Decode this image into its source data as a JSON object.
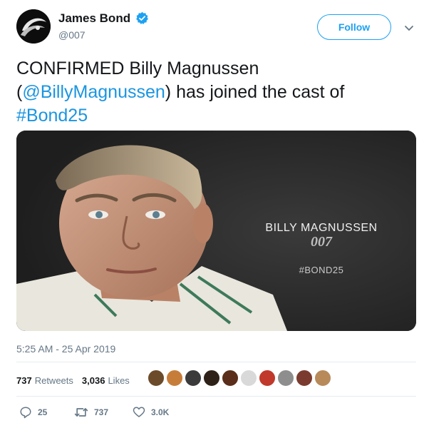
{
  "header": {
    "display_name": "James Bond",
    "handle": "@007",
    "follow_label": "Follow",
    "verified_icon": "verified-badge-icon",
    "menu_icon": "chevron-down-icon"
  },
  "tweet": {
    "text_part1": "CONFIRMED Billy Magnussen",
    "text_paren_open": "(",
    "mention": "@BillyMagnussen",
    "text_part2": ") has joined the cast of",
    "hashtag": "#Bond25"
  },
  "media": {
    "title": "BILLY MAGNUSSEN",
    "logo": "007",
    "tag": "#BOND25"
  },
  "timestamp": "5:25 AM - 25 Apr 2019",
  "stats": {
    "retweets_count": "737",
    "retweets_label": "Retweets",
    "likes_count": "3,036",
    "likes_label": "Likes"
  },
  "actions": {
    "reply_count": "25",
    "retweet_count": "737",
    "like_count": "3.0K"
  },
  "colors": {
    "accent": "#1da1f2",
    "link": "#1b95e0",
    "muted": "#657786"
  }
}
